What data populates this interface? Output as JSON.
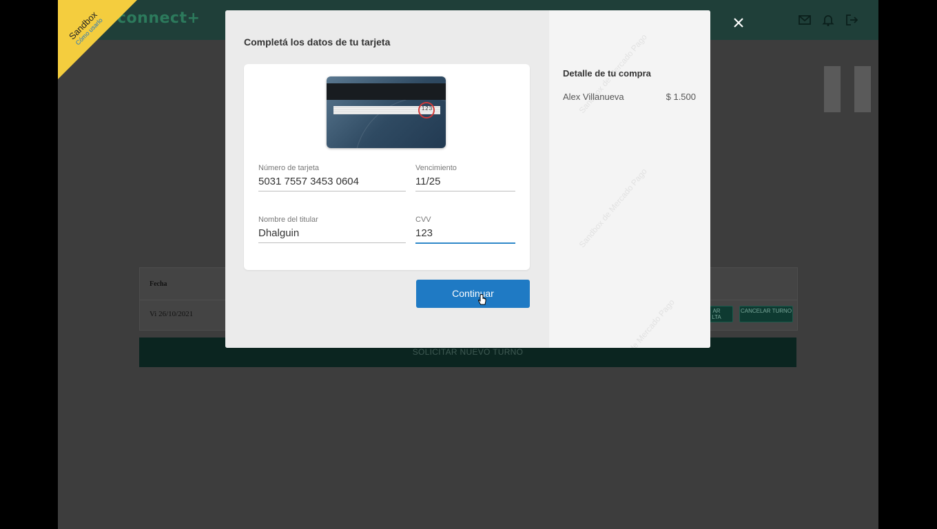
{
  "app": {
    "logo": "connect+",
    "icons": [
      "mail-icon",
      "bell-icon",
      "logout-icon"
    ],
    "table": {
      "header_date": "Fecha",
      "row_date": "Vi 26/10/2021",
      "partial_button": "AR\nLTA",
      "cancel_button": "CANCELAR TURNO"
    },
    "new_turn_button": "SOLICITAR NUEVO TURNO"
  },
  "sandbox": {
    "label": "Sandbox",
    "link": "Cómo usarlo"
  },
  "modal": {
    "title": "Completá los datos de tu tarjeta",
    "card_sample_cvv": "123",
    "fields": {
      "card_number": {
        "label": "Número de tarjeta",
        "value": "5031 7557 3453 0604"
      },
      "expiry": {
        "label": "Vencimiento",
        "value": "11/25"
      },
      "holder": {
        "label": "Nombre del titular",
        "value": "Dhalguin"
      },
      "cvv": {
        "label": "CVV",
        "value": "123"
      }
    },
    "continue_label": "Continuar",
    "summary": {
      "title": "Detalle de tu compra",
      "item_name": "Alex Villanueva",
      "item_amount": "$ 1.500"
    },
    "watermark": "Sandbox de Mercado Pago"
  },
  "colors": {
    "primary_button": "#1f7ac4",
    "active_underline": "#2e87c8",
    "sandbox_ribbon": "#f4cd3e",
    "header_bg": "#1f3f39"
  }
}
